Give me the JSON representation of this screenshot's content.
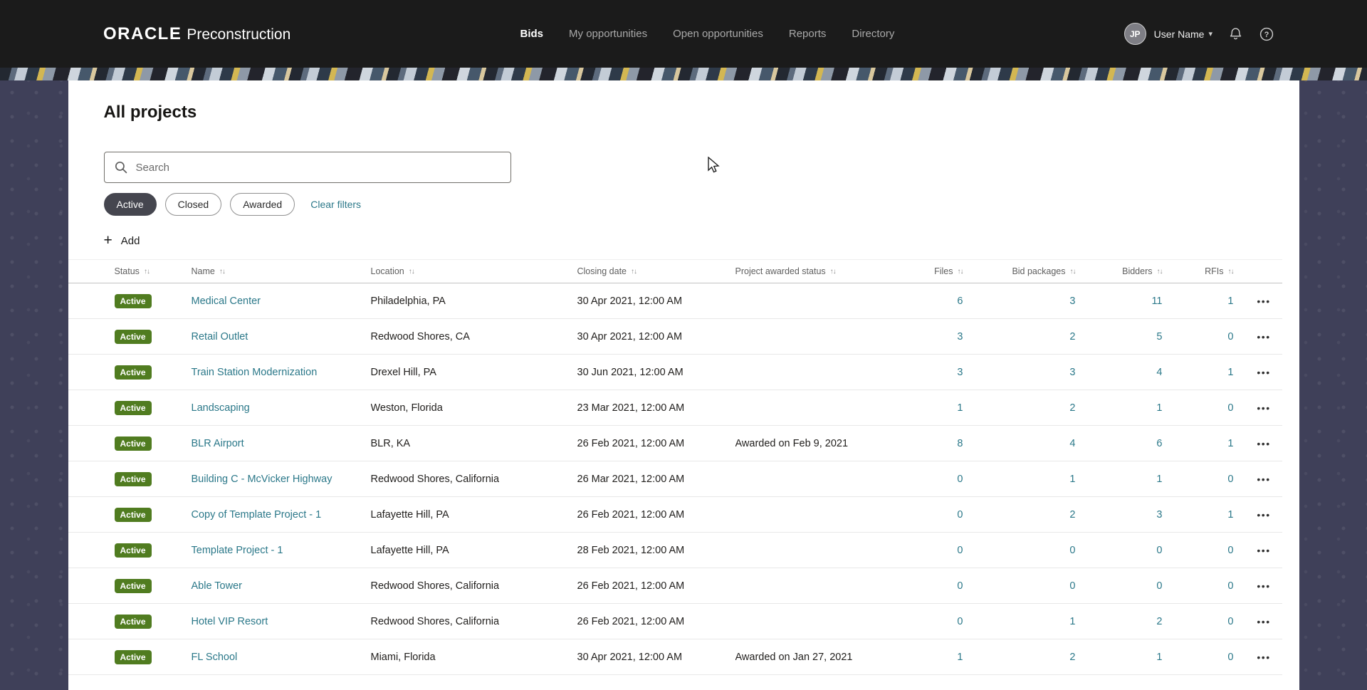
{
  "header": {
    "logo": {
      "brand": "ORACLE",
      "product": "Preconstruction"
    },
    "nav": [
      {
        "label": "Bids",
        "active": true
      },
      {
        "label": "My opportunities",
        "active": false
      },
      {
        "label": "Open opportunities",
        "active": false
      },
      {
        "label": "Reports",
        "active": false
      },
      {
        "label": "Directory",
        "active": false
      }
    ],
    "user": {
      "initials": "JP",
      "name": "User Name"
    }
  },
  "page": {
    "title": "All projects"
  },
  "search": {
    "placeholder": "Search"
  },
  "filters": {
    "chips": [
      {
        "label": "Active",
        "selected": true
      },
      {
        "label": "Closed",
        "selected": false
      },
      {
        "label": "Awarded",
        "selected": false
      }
    ],
    "clear_label": "Clear filters"
  },
  "toolbar": {
    "add_label": "Add"
  },
  "table": {
    "columns": [
      "Status",
      "Name",
      "Location",
      "Closing date",
      "Project awarded status",
      "Files",
      "Bid packages",
      "Bidders",
      "RFIs"
    ],
    "rows": [
      {
        "status": "Active",
        "name": "Medical Center",
        "location": "Philadelphia, PA",
        "closing": "30 Apr 2021, 12:00 AM",
        "awarded": "",
        "files": "6",
        "bid_packages": "3",
        "bidders": "11",
        "rfis": "1"
      },
      {
        "status": "Active",
        "name": "Retail Outlet",
        "location": "Redwood Shores, CA",
        "closing": "30 Apr 2021, 12:00 AM",
        "awarded": "",
        "files": "3",
        "bid_packages": "2",
        "bidders": "5",
        "rfis": "0"
      },
      {
        "status": "Active",
        "name": "Train Station Modernization",
        "location": "Drexel Hill, PA",
        "closing": "30 Jun 2021, 12:00 AM",
        "awarded": "",
        "files": "3",
        "bid_packages": "3",
        "bidders": "4",
        "rfis": "1"
      },
      {
        "status": "Active",
        "name": "Landscaping",
        "location": "Weston, Florida",
        "closing": "23 Mar 2021, 12:00 AM",
        "awarded": "",
        "files": "1",
        "bid_packages": "2",
        "bidders": "1",
        "rfis": "0"
      },
      {
        "status": "Active",
        "name": "BLR Airport",
        "location": "BLR, KA",
        "closing": "26 Feb 2021, 12:00 AM",
        "awarded": "Awarded on Feb 9, 2021",
        "files": "8",
        "bid_packages": "4",
        "bidders": "6",
        "rfis": "1"
      },
      {
        "status": "Active",
        "name": "Building C - McVicker Highway",
        "location": "Redwood Shores, California",
        "closing": "26 Mar 2021, 12:00 AM",
        "awarded": "",
        "files": "0",
        "bid_packages": "1",
        "bidders": "1",
        "rfis": "0"
      },
      {
        "status": "Active",
        "name": "Copy of Template Project - 1",
        "location": "Lafayette Hill, PA",
        "closing": "26 Feb 2021, 12:00 AM",
        "awarded": "",
        "files": "0",
        "bid_packages": "2",
        "bidders": "3",
        "rfis": "1"
      },
      {
        "status": "Active",
        "name": "Template Project - 1",
        "location": "Lafayette Hill, PA",
        "closing": "28 Feb 2021, 12:00 AM",
        "awarded": "",
        "files": "0",
        "bid_packages": "0",
        "bidders": "0",
        "rfis": "0"
      },
      {
        "status": "Active",
        "name": "Able Tower",
        "location": "Redwood Shores, California",
        "closing": "26 Feb 2021, 12:00 AM",
        "awarded": "",
        "files": "0",
        "bid_packages": "0",
        "bidders": "0",
        "rfis": "0"
      },
      {
        "status": "Active",
        "name": "Hotel VIP Resort",
        "location": "Redwood Shores, California",
        "closing": "26 Feb 2021, 12:00 AM",
        "awarded": "",
        "files": "0",
        "bid_packages": "1",
        "bidders": "2",
        "rfis": "0"
      },
      {
        "status": "Active",
        "name": "FL School",
        "location": "Miami, Florida",
        "closing": "30 Apr 2021, 12:00 AM",
        "awarded": "Awarded on Jan 27, 2021",
        "files": "1",
        "bid_packages": "2",
        "bidders": "1",
        "rfis": "0"
      }
    ]
  },
  "icons": {
    "sort": "↑↓",
    "more": "•••",
    "plus": "+",
    "caret": "▾"
  },
  "colors": {
    "header_bg": "#1b1b1b",
    "page_bg": "#3f4059",
    "card_bg": "#ffffff",
    "badge_green": "#507c20",
    "link_teal": "#2b7889",
    "chip_selected_bg": "#45464f",
    "banner_gold": "#d3b752"
  }
}
